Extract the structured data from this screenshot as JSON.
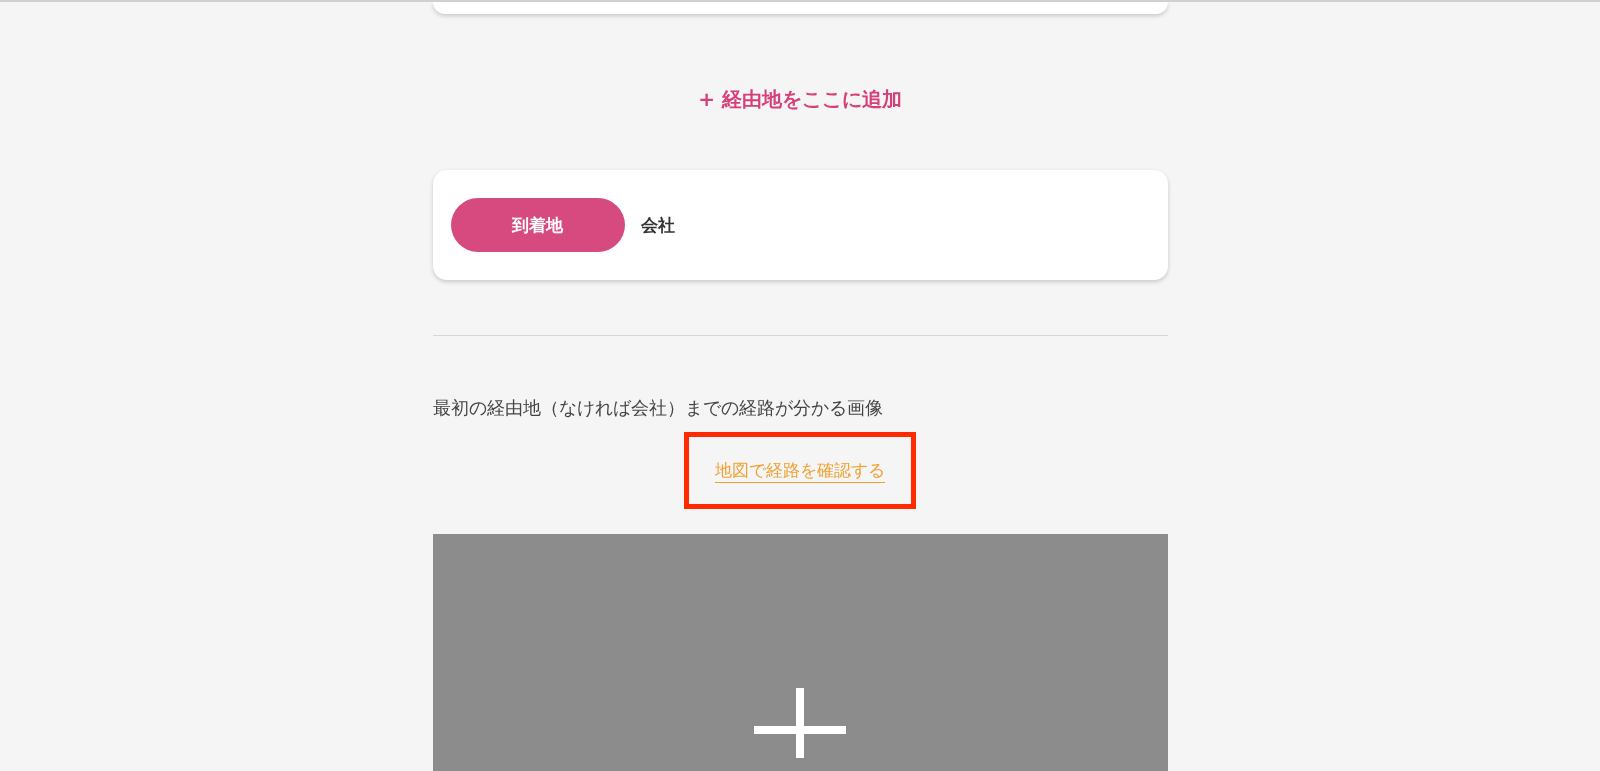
{
  "add_waypoint": {
    "icon": "+",
    "label": "経由地をここに追加"
  },
  "destination": {
    "badge": "到着地",
    "value": "会社"
  },
  "route_image": {
    "caption": "最初の経由地（なければ会社）までの経路が分かる画像",
    "map_link": {
      "label": "地図で経路を確認する",
      "highlighted": true
    }
  }
}
